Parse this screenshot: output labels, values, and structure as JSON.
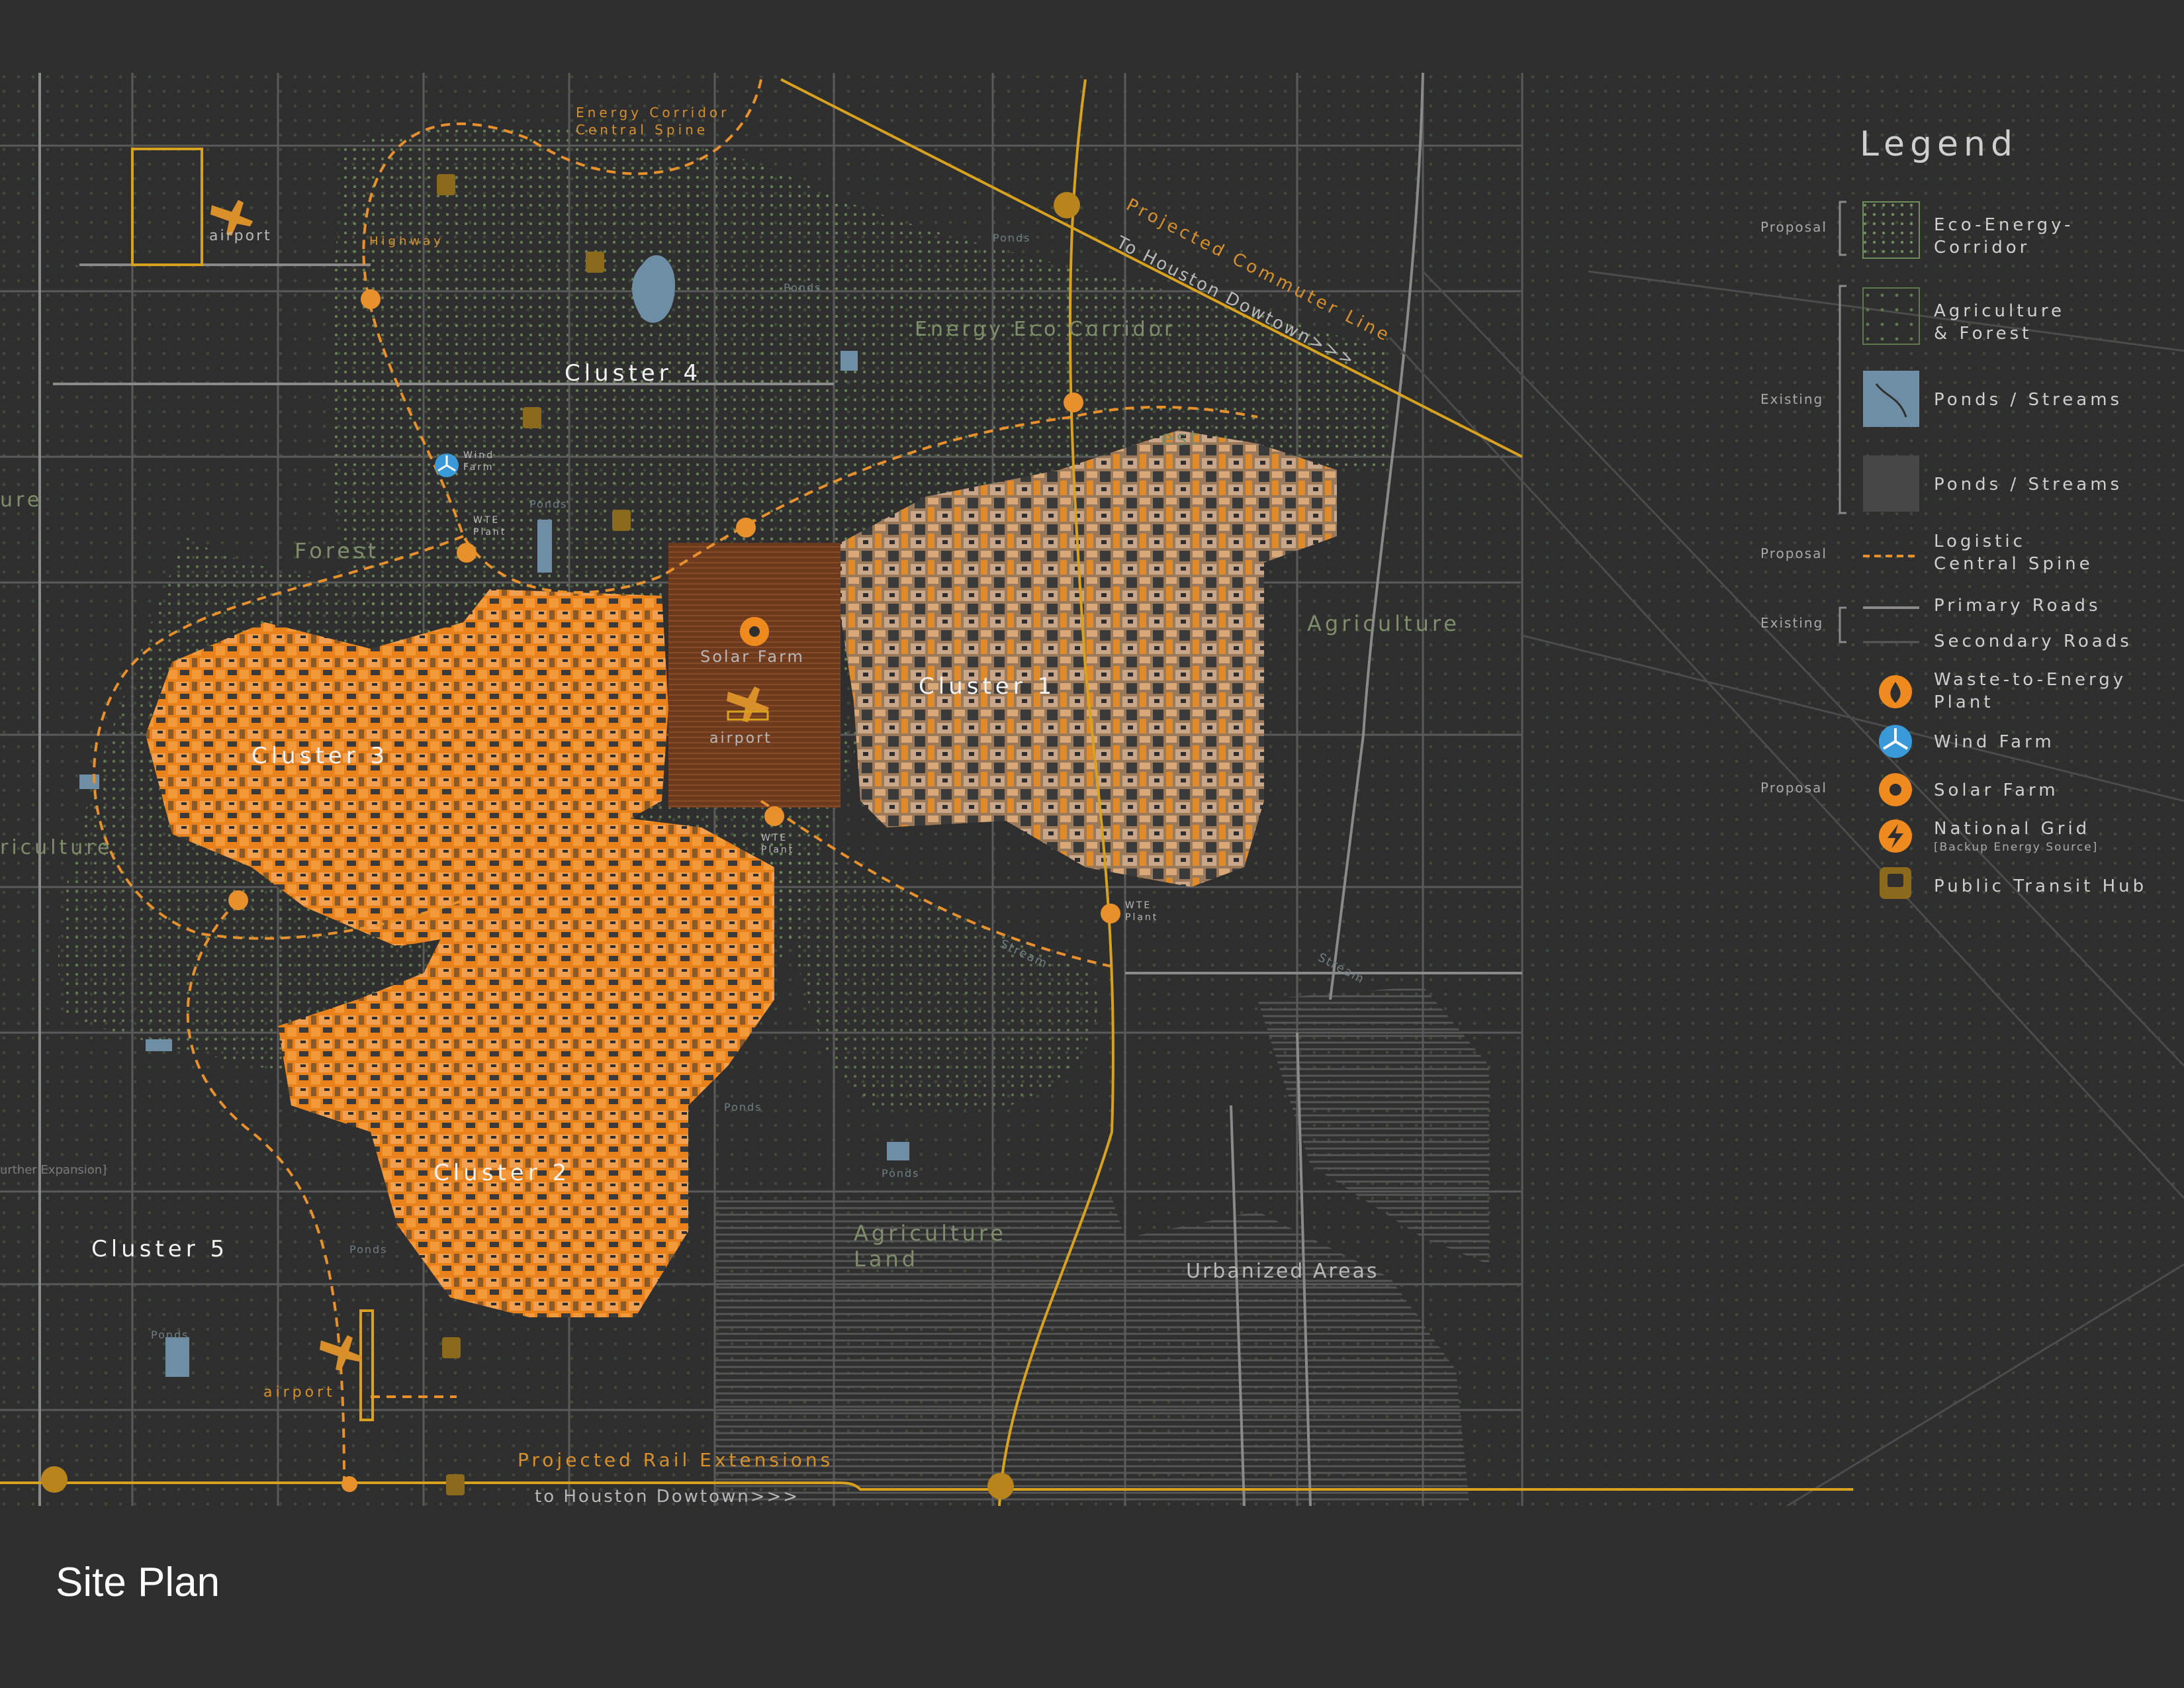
{
  "title": "Site Plan",
  "colors": {
    "background": "#2f2f2f",
    "cluster_orange": "#ef8a1e",
    "rail_yellow": "#d8a21f",
    "spine_orange": "#e8912c",
    "corridor_green": "#6f8f5a",
    "pond_blue": "#6e8ea5",
    "wind_blue": "#3a9ad9",
    "roads": "#8a8a8a"
  },
  "clusters": {
    "c1": "Cluster 1",
    "c2": "Cluster 2",
    "c3": "Cluster 3",
    "c4": "Cluster 4",
    "c5": "Cluster 5"
  },
  "labels": {
    "energy_corridor_line1": "Energy Corridor",
    "energy_corridor_line2": "Central Spine",
    "airport": "airport",
    "highway": "Highway",
    "ponds": "Ponds",
    "wind_farm_line1": "Wind",
    "wind_farm_line2": "Farm",
    "wte_line1": "WTE",
    "wte_line2": "Plant",
    "forest": "Forest",
    "forest_partial": "est",
    "culture_partial": "ure",
    "agriculture_partial": "riculture",
    "energy_eco_corridor": "Energy Eco Corridor",
    "agriculture": "Agriculture",
    "solar_farm": "Solar Farm",
    "stream": "Stream",
    "agriculture_land_line1": "Agriculture",
    "agriculture_land_line2": "Land",
    "urbanized_areas": "Urbanized Areas",
    "further_expansion": "urther Expansion]",
    "projected_commuter_line": "Projected Commuter Line",
    "to_houston_downtown": "To Houston Dowtown>>>",
    "projected_rail_extensions": "Projected Rail Extensions",
    "to_houston_downtown_bottom": "to Houston Dowtown>>>"
  },
  "legend": {
    "title": "Legend",
    "items": [
      {
        "tag": "Proposal",
        "line1": "Eco-Energy-",
        "line2": "Corridor",
        "icon": "eco-energy-corridor-swatch"
      },
      {
        "tag": "",
        "line1": "Agriculture",
        "line2": "& Forest",
        "icon": "agriculture-forest-swatch"
      },
      {
        "tag": "Existing",
        "line1": "Ponds / Streams",
        "line2": "",
        "icon": "ponds-streams-swatch"
      },
      {
        "tag": "",
        "line1": "Ponds / Streams",
        "line2": "",
        "icon": "urban-swatch"
      },
      {
        "tag": "Proposal",
        "line1": "Logistic",
        "line2": "Central Spine",
        "icon": "logistic-spine-line"
      },
      {
        "tag": "Existing",
        "line1": "Primary Roads",
        "line2": "",
        "icon": "primary-roads-line"
      },
      {
        "tag": "",
        "line1": "Secondary Roads",
        "line2": "",
        "icon": "secondary-roads-line"
      },
      {
        "tag": "",
        "line1": "Waste-to-Energy",
        "line2": "Plant",
        "icon": "flame-icon"
      },
      {
        "tag": "",
        "line1": "Wind Farm",
        "line2": "",
        "icon": "wind-turbine-icon"
      },
      {
        "tag": "Proposal",
        "line1": "Solar Farm",
        "line2": "",
        "icon": "solar-icon"
      },
      {
        "tag": "",
        "line1": "National Grid",
        "line2": "[Backup Energy Source]",
        "icon": "lightning-icon"
      },
      {
        "tag": "",
        "line1": "Public Transit Hub",
        "line2": "",
        "icon": "transit-icon"
      }
    ]
  }
}
